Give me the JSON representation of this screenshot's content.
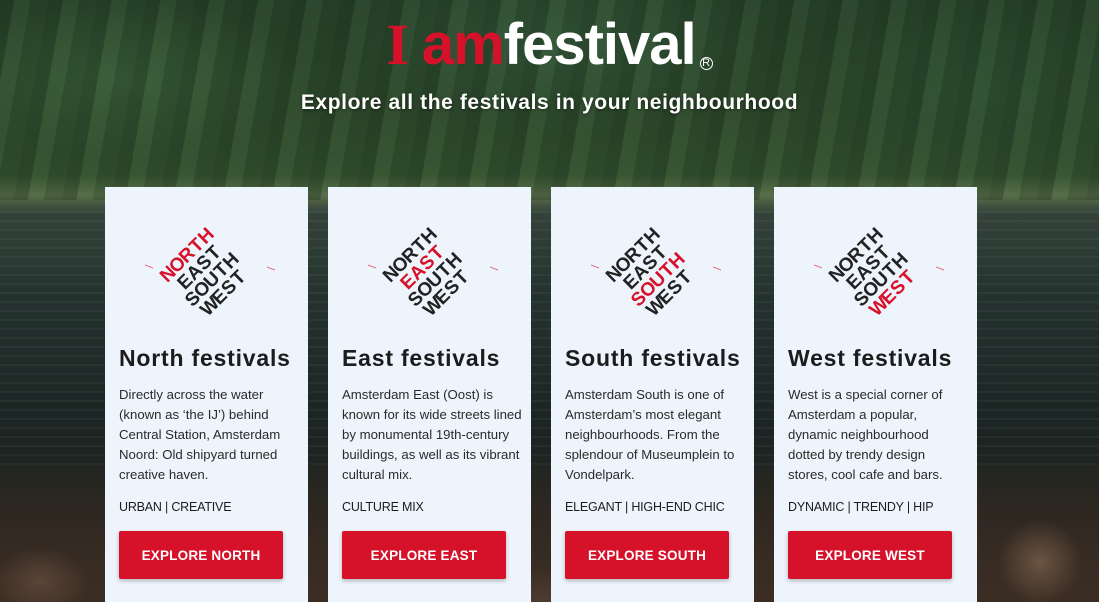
{
  "brand": {
    "logo_i": "I",
    "logo_am": "am",
    "logo_festival": "festival",
    "logo_registered": "R",
    "tagline": "Explore all the festivals in your neighbourhood",
    "accent_color": "#d6112a"
  },
  "emblem_words": [
    "NORTH",
    "EAST",
    "SOUTH",
    "WEST"
  ],
  "cards": [
    {
      "highlight": "NORTH",
      "title": "North festivals",
      "description": "Directly across the water (known as ‘the IJ’) behind Central Station, Amsterdam Noord: Old shipyard turned creative haven.",
      "tags": "URBAN | CREATIVE",
      "button": "EXPLORE NORTH"
    },
    {
      "highlight": "EAST",
      "title": "East festivals",
      "description": "Amsterdam East (Oost) is known for its wide streets lined by monumental 19th-century buildings, as well as its vibrant cultural mix.",
      "tags": "CULTURE MIX",
      "button": "EXPLORE EAST"
    },
    {
      "highlight": "SOUTH",
      "title": "South festivals",
      "description": "Amsterdam South is one of Amsterdam’s most elegant neighbourhoods. From the splendour of Museumplein to Vondelpark.",
      "tags": "ELEGANT | HIGH-END CHIC",
      "button": "EXPLORE SOUTH"
    },
    {
      "highlight": "WEST",
      "title": "West festivals",
      "description": "West is a special corner of Amsterdam a popular, dynamic neighbourhood dotted by trendy design stores, cool cafe and bars.",
      "tags": "DYNAMIC | TRENDY | HIP",
      "button": "EXPLORE WEST"
    }
  ]
}
